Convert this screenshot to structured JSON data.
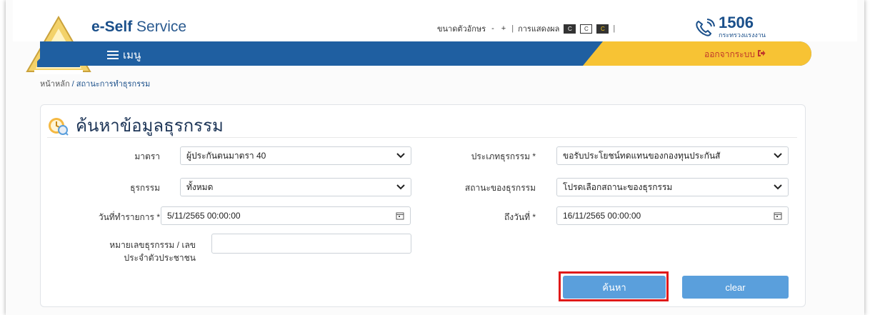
{
  "header": {
    "brand_bold": "e-Self",
    "brand_rest": " Service",
    "font_size_label": "ขนาดตัวอักษร",
    "font_minus": "-",
    "font_plus": "+",
    "display_label": "การแสดงผล",
    "contrast_options": [
      "C",
      "C",
      "C"
    ],
    "hotline_number": "1506",
    "hotline_sub": "กระทรวงแรงงาน"
  },
  "nav": {
    "menu_label": "เมนู",
    "logout_label": "ออกจากระบบ"
  },
  "breadcrumb": {
    "home": "หน้าหลัก",
    "separator": " / ",
    "current": "สถานะการทำธุรกรรม"
  },
  "card": {
    "title": "ค้นหาข้อมูลธุรกรรม"
  },
  "form": {
    "section": {
      "label": "มาตรา",
      "value": "ผู้ประกันตนมาตรา 40"
    },
    "transaction_type": {
      "label": "ประเภทธุรกรรม *",
      "value": "ขอรับประโยชน์ทดแทนของกองทุนประกันสั"
    },
    "transaction": {
      "label": "ธุรกรรม",
      "value": "ทั้งหมด"
    },
    "transaction_status": {
      "label": "สถานะของธุรกรรม",
      "value": "โปรดเลือกสถานะของธุรกรรม"
    },
    "date_from": {
      "label": "วันที่ทำรายการ *",
      "value": "5/11/2565 00:00:00"
    },
    "date_to": {
      "label": "ถึงวันที่ *",
      "value": "16/11/2565 00:00:00"
    },
    "ref_number": {
      "label_line1": "หมายเลขธุรกรรม / เลข",
      "label_line2": "ประจำตัวประชาชน",
      "value": ""
    }
  },
  "buttons": {
    "search": "ค้นหา",
    "clear": "clear"
  },
  "colors": {
    "nav_blue": "#1f5fa1",
    "nav_yellow": "#f7c334",
    "button_blue": "#5a9fdc",
    "highlight_red": "#e01919"
  },
  "icons": {
    "menu": "hamburger-icon",
    "logout": "logout-icon",
    "title": "clock-search-icon",
    "dropdown": "chevron-down-icon",
    "calendar": "calendar-icon",
    "hotline": "phone-icon"
  }
}
